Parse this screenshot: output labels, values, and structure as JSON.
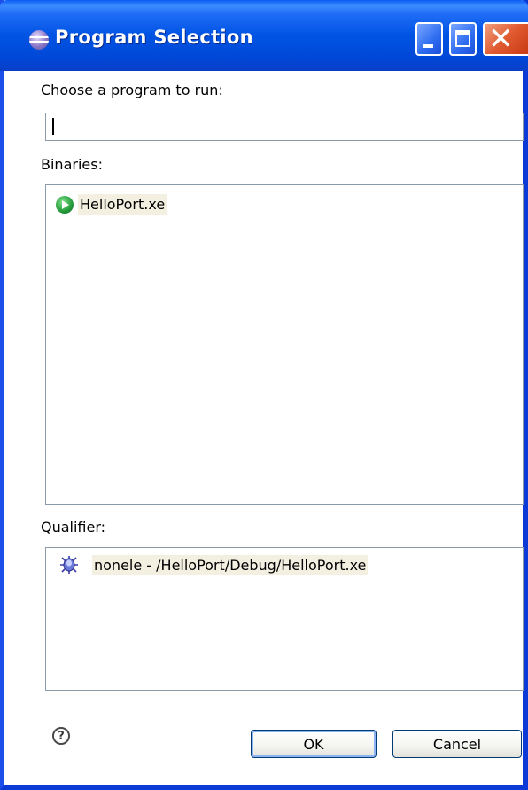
{
  "window": {
    "title": "Program Selection",
    "title_icon": "eclipse-icon",
    "controls": {
      "minimize_icon": "minimize-icon",
      "maximize_icon": "maximize-icon",
      "close_icon": "close-icon",
      "close_glyph": "✕"
    }
  },
  "program_prompt": {
    "label": "Choose a program to run:",
    "value": ""
  },
  "binaries": {
    "label": "Binaries:",
    "items": [
      {
        "label": "HelloPort.xe",
        "icon": "run-icon"
      }
    ]
  },
  "qualifier": {
    "label": "Qualifier:",
    "items": [
      {
        "label": "nonele - /HelloPort/Debug/HelloPort.xe",
        "icon": "debug-bug-icon"
      }
    ]
  },
  "footer": {
    "help_glyph": "?",
    "ok_label": "OK",
    "cancel_label": "Cancel"
  },
  "colors": {
    "titlebar": "#0054e3",
    "close_button": "#e05a30",
    "selection": "#f3f0e2"
  }
}
